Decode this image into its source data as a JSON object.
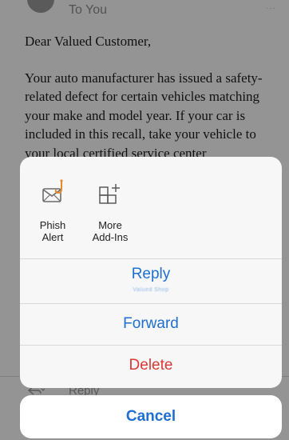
{
  "email": {
    "recipient_line": "To You",
    "more_dots": "···",
    "greeting": "Dear Valued Customer,",
    "body": "Your auto manufacturer has issued a safety-related defect for certain vehicles matching your make and model year. If your car is included in this recall, take your vehicle to your local certified service center",
    "quick_reply_label": "Reply",
    "quick_reply_icon": "reply-icon"
  },
  "sheet": {
    "addins": [
      {
        "label": "Phish\nAlert",
        "icon": "phish-alert-icon"
      },
      {
        "label": "More\nAdd-Ins",
        "icon": "add-ins-icon"
      }
    ],
    "reply_label": "Reply",
    "reply_sub": "Valued Shop",
    "forward_label": "Forward",
    "delete_label": "Delete",
    "cancel_label": "Cancel"
  },
  "colors": {
    "accent": "#1f6fd1",
    "destructive": "#d93a36",
    "phish_hook": "#e8892b"
  }
}
